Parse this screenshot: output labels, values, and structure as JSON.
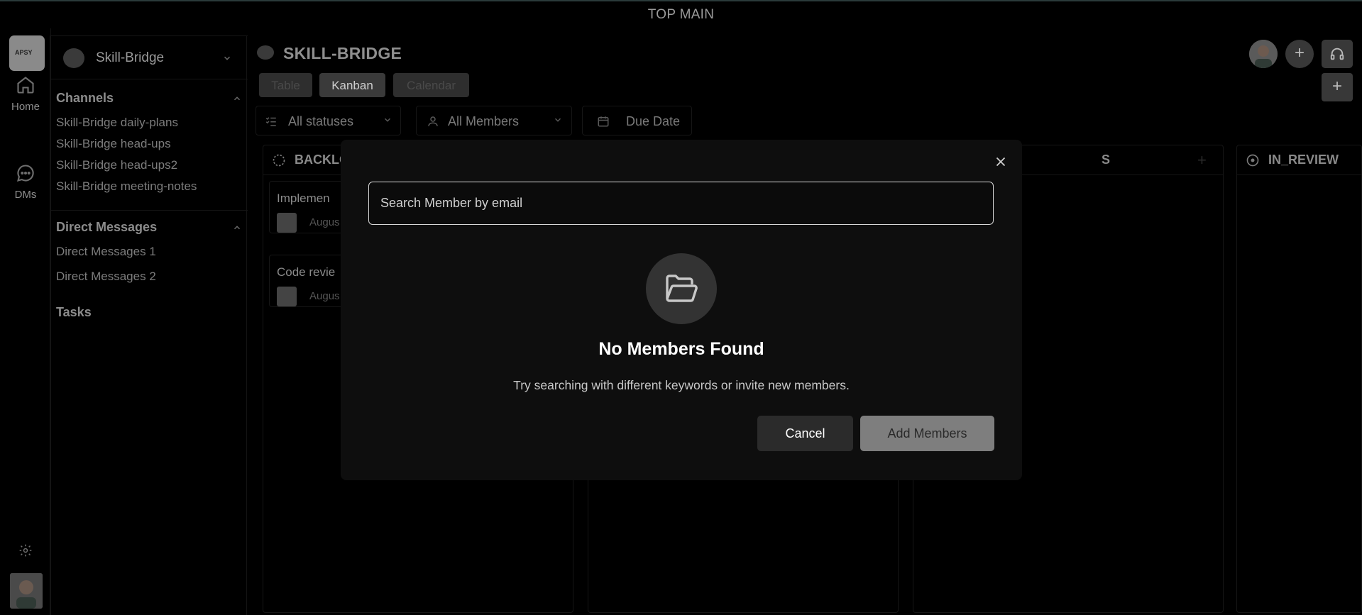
{
  "top_bar": {
    "title": "TOP MAIN"
  },
  "rail": {
    "logo_text": "APSY",
    "items": [
      {
        "label": "Home",
        "icon": "home-icon"
      },
      {
        "label": "DMs",
        "icon": "chat-icon"
      }
    ]
  },
  "sidebar": {
    "workspace": "Skill-Bridge",
    "channels_title": "Channels",
    "channels": [
      "Skill-Bridge daily-plans",
      "Skill-Bridge head-ups",
      "Skill-Bridge head-ups2",
      "Skill-Bridge meeting-notes"
    ],
    "dm_title": "Direct Messages",
    "dms": [
      "Direct Messages 1",
      "Direct Messages 2"
    ],
    "tasks_title": "Tasks"
  },
  "main": {
    "project_title": "SKILL-BRIDGE",
    "view_tabs": [
      "Table",
      "Kanban",
      "Calendar"
    ],
    "active_view": "Kanban",
    "filters": {
      "status": "All statuses",
      "members": "All Members",
      "due": "Due Date"
    },
    "columns": [
      {
        "title": "BACKLO"
      },
      {
        "title": "S"
      },
      {
        "title": "IN_REVIEW"
      }
    ],
    "cards": [
      {
        "title": "Implemen",
        "date": "Augus"
      },
      {
        "title": "Code revie",
        "date": "Augus"
      }
    ]
  },
  "modal": {
    "search_placeholder": "Search Member by email",
    "empty_title": "No Members Found",
    "empty_subtitle": "Try searching with different keywords or invite new members.",
    "cancel_label": "Cancel",
    "add_label": "Add Members"
  },
  "colors": {
    "background": "#000000",
    "modal_bg": "#0e0e0e",
    "primary_disabled": "#7e7e7e",
    "secondary": "#2b2b2b"
  }
}
